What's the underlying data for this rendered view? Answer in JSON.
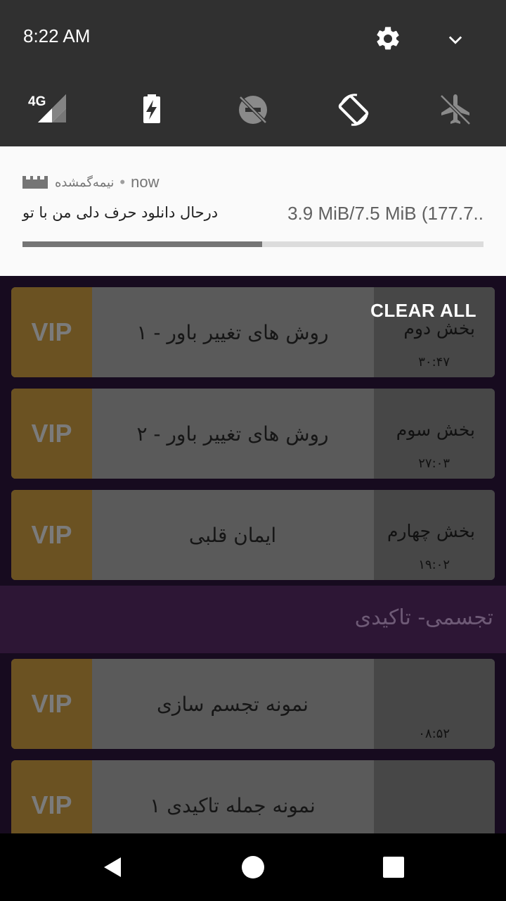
{
  "status": {
    "time": "8:22 AM"
  },
  "quick_settings": [
    {
      "name": "4G signal",
      "icon": "signal-4g-icon"
    },
    {
      "name": "Battery saver",
      "icon": "battery-charging-icon"
    },
    {
      "name": "Do not disturb",
      "icon": "dnd-off-icon"
    },
    {
      "name": "Auto-rotate",
      "icon": "auto-rotate-icon"
    },
    {
      "name": "Airplane mode",
      "icon": "airplane-icon"
    }
  ],
  "notification": {
    "app_name": "نیمه‌گمشده",
    "time": "now",
    "title": "درحال دانلود حرف دلی من با تو",
    "progress_text": "3.9 MiB/7.5 MiB (177.7..",
    "progress": 0.52
  },
  "clear_all": "CLEAR ALL",
  "cards": [
    {
      "vip": "VIP",
      "title": "روش های تغییر باور - ۱",
      "section": "بخش دوم",
      "duration": "۳۰:۴۷"
    },
    {
      "vip": "VIP",
      "title": "روش های تغییر باور - ۲",
      "section": "بخش سوم",
      "duration": "۲۷:۰۳"
    },
    {
      "vip": "VIP",
      "title": "ایمان قلبی",
      "section": "بخش چهارم",
      "duration": "۱۹:۰۲"
    }
  ],
  "category": "تجسمی- تاکیدی",
  "cards2": [
    {
      "vip": "VIP",
      "title": "نمونه تجسم سازی",
      "section": "",
      "duration": "۰۸:۵۲"
    },
    {
      "vip": "VIP",
      "title": "نمونه جمله تاکیدی ۱",
      "section": "",
      "duration": ""
    }
  ],
  "colors": {
    "vip_bg": "#6b5222",
    "card_bg": "#5a5a5a",
    "shade_bg": "#303030",
    "progress": "#757575"
  }
}
